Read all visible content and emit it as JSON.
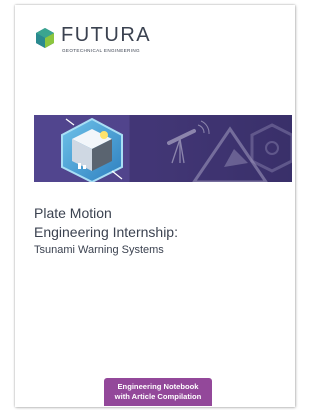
{
  "brand": {
    "name": "FUTURA",
    "tagline": "GEOTECHNICAL ENGINEERING",
    "logo_icon": "hexagon-logo-icon",
    "colors": {
      "teal": "#3aa58f",
      "blue": "#2e6da4",
      "green": "#8cc63f"
    }
  },
  "banner": {
    "icons": [
      "cube-lab-icon",
      "telescope-icon",
      "pyramid-icon",
      "hexagon-outline-icon"
    ],
    "colors": {
      "background": "#4b3f86",
      "accent": "#5eb7e4"
    }
  },
  "title": {
    "line1": "Plate Motion",
    "line2": "Engineering Internship:"
  },
  "subtitle": "Tsunami Warning Systems",
  "badge": {
    "line1": "Engineering Notebook",
    "line2": "with Article Compilation",
    "color": "#93489a"
  }
}
